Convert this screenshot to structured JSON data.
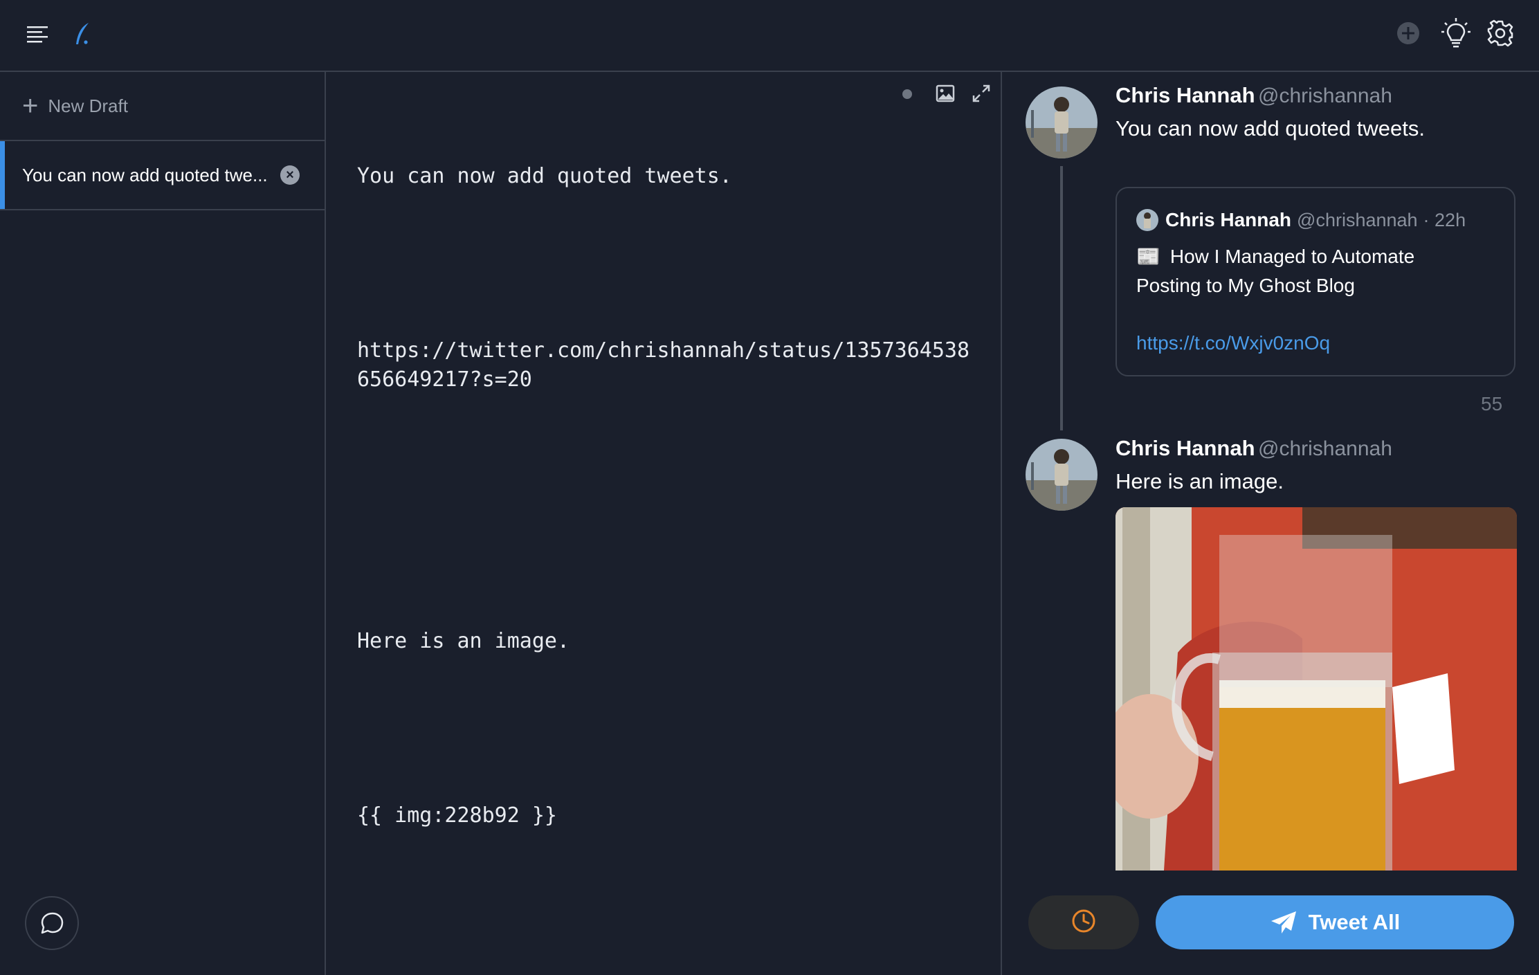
{
  "toolbar": {
    "menu_icon": "hamburger-menu-icon",
    "logo_icon": "quill-logo-icon",
    "add_icon": "plus-circle-icon",
    "tips_icon": "lightbulb-icon",
    "settings_icon": "gear-icon"
  },
  "sidebar": {
    "new_draft_label": "New Draft",
    "drafts": [
      {
        "label": "You can now add quoted twe..."
      }
    ],
    "chat_icon": "chat-bubble-icon"
  },
  "editor": {
    "lines": [
      "You can now add quoted tweets.",
      "",
      "https://twitter.com/chrishannah/status/1357364538656649217?s=20",
      "",
      "",
      "Here is an image.",
      "",
      "{{ img:228b92 }}"
    ],
    "status_icon": "status-dot-icon",
    "image_icon": "image-icon",
    "expand_icon": "expand-icon"
  },
  "preview": {
    "tweets": [
      {
        "name": "Chris Hannah",
        "handle": "@chrishannah",
        "text": "You can now add quoted tweets.",
        "quote": {
          "name": "Chris Hannah",
          "handle": "@chrishannah",
          "time": "· 22h",
          "emoji": "📰",
          "text_line1": "How I Managed to Automate",
          "text_line2": "Posting to My Ghost Blog",
          "link": "https://t.co/Wxjv0znOq"
        },
        "char_count": "55"
      },
      {
        "name": "Chris Hannah",
        "handle": "@chrishannah",
        "text": "Here is an image."
      }
    ],
    "schedule_icon": "clock-icon",
    "tweet_all_label": "Tweet All",
    "send_icon": "paper-plane-icon"
  },
  "colors": {
    "background": "#1a1f2c",
    "accent": "#4a9be8",
    "schedule": "#e8862a"
  }
}
